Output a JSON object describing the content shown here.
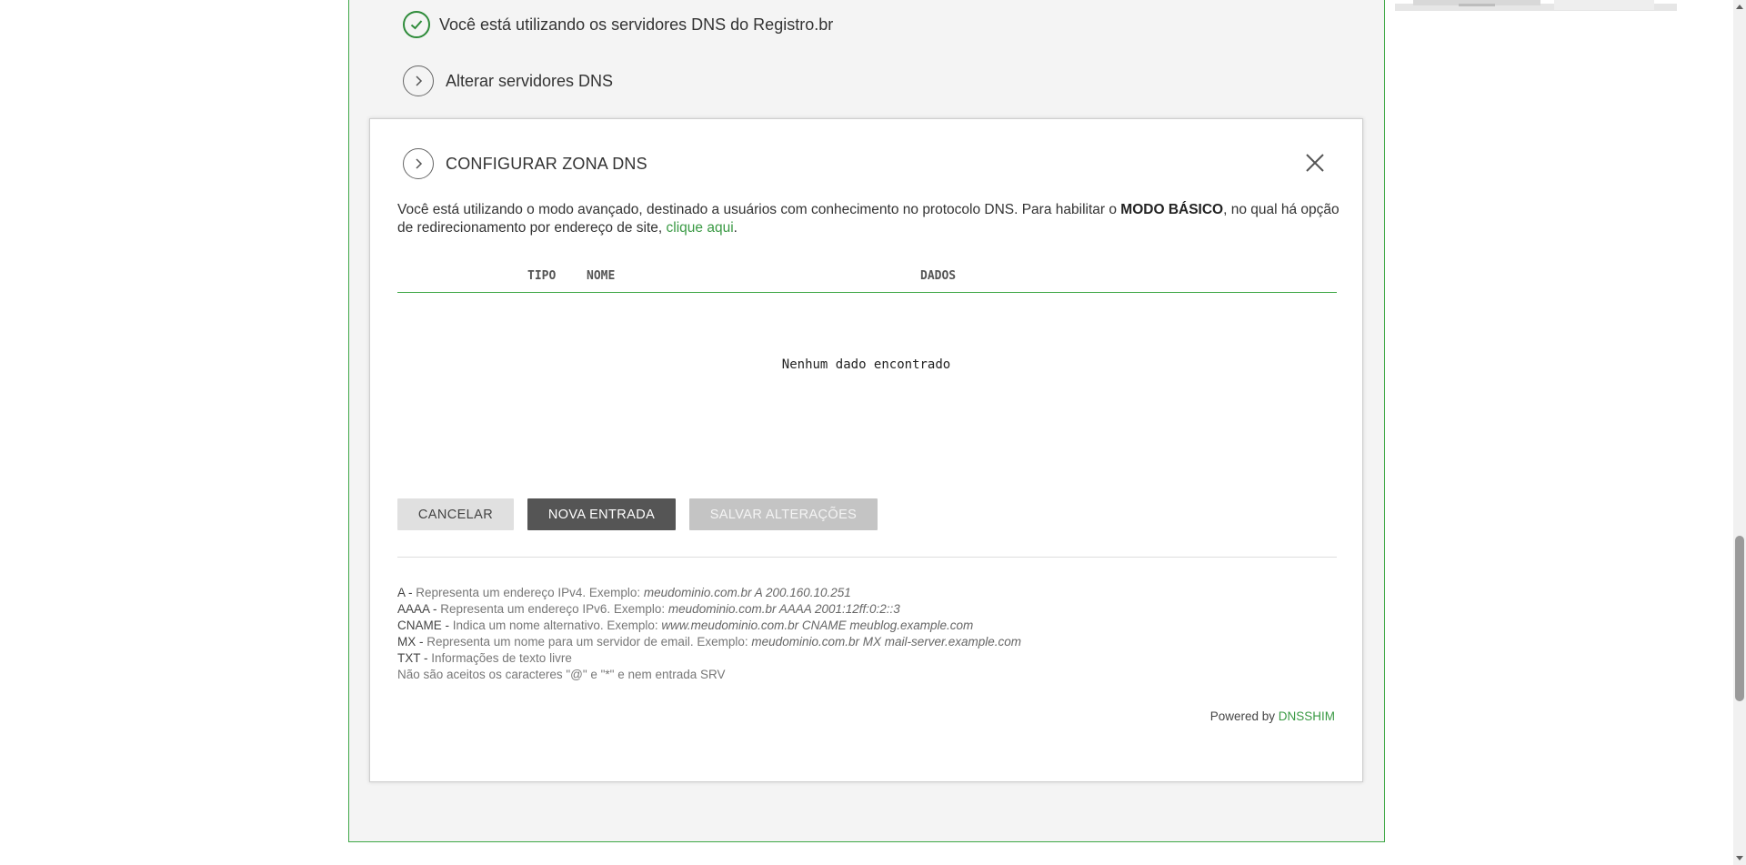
{
  "status": {
    "dns_in_use": "Você está utilizando os servidores DNS do Registro.br",
    "change_servers": "Alterar servidores DNS"
  },
  "modal": {
    "title": "CONFIGURAR ZONA DNS",
    "intro_part1": "Você está utilizando o modo avançado, destinado a usuários com conhecimento no protocolo DNS. Para habilitar o ",
    "intro_mode": "MODO BÁSICO",
    "intro_part2": ", no qual há opção de redirecionamento por endereço de site, ",
    "intro_link": "clique aqui",
    "intro_end": ".",
    "table": {
      "headers": [
        "TIPO",
        "NOME",
        "DADOS"
      ],
      "empty": "Nenhum dado encontrado"
    },
    "buttons": {
      "cancel": "CANCELAR",
      "new_entry": "NOVA ENTRADA",
      "save": "SALVAR ALTERAÇÕES"
    },
    "legend": [
      {
        "key": "A -",
        "desc": " Representa um endereço IPv4. Exemplo: ",
        "example": "meudominio.com.br A 200.160.10.251"
      },
      {
        "key": "AAAA -",
        "desc": " Representa um endereço IPv6. Exemplo: ",
        "example": "meudominio.com.br AAAA 2001:12ff:0:2::3"
      },
      {
        "key": "CNAME -",
        "desc": " Indica um nome alternativo. Exemplo: ",
        "example": "www.meudominio.com.br CNAME meublog.example.com"
      },
      {
        "key": "MX -",
        "desc": " Representa um nome para um servidor de email. Exemplo: ",
        "example": "meudominio.com.br MX mail-server.example.com"
      },
      {
        "key": "TXT -",
        "desc": " Informações de texto livre",
        "example": ""
      }
    ],
    "legend_note": "Não são aceitos os caracteres \"@\" e \"*\" e nem entrada SRV",
    "powered_by": "Powered by ",
    "powered_brand": "DNSSHIM"
  },
  "colors": {
    "accent_green": "#3fa847",
    "link_green": "#3a9a44",
    "dark_button": "#555555"
  }
}
